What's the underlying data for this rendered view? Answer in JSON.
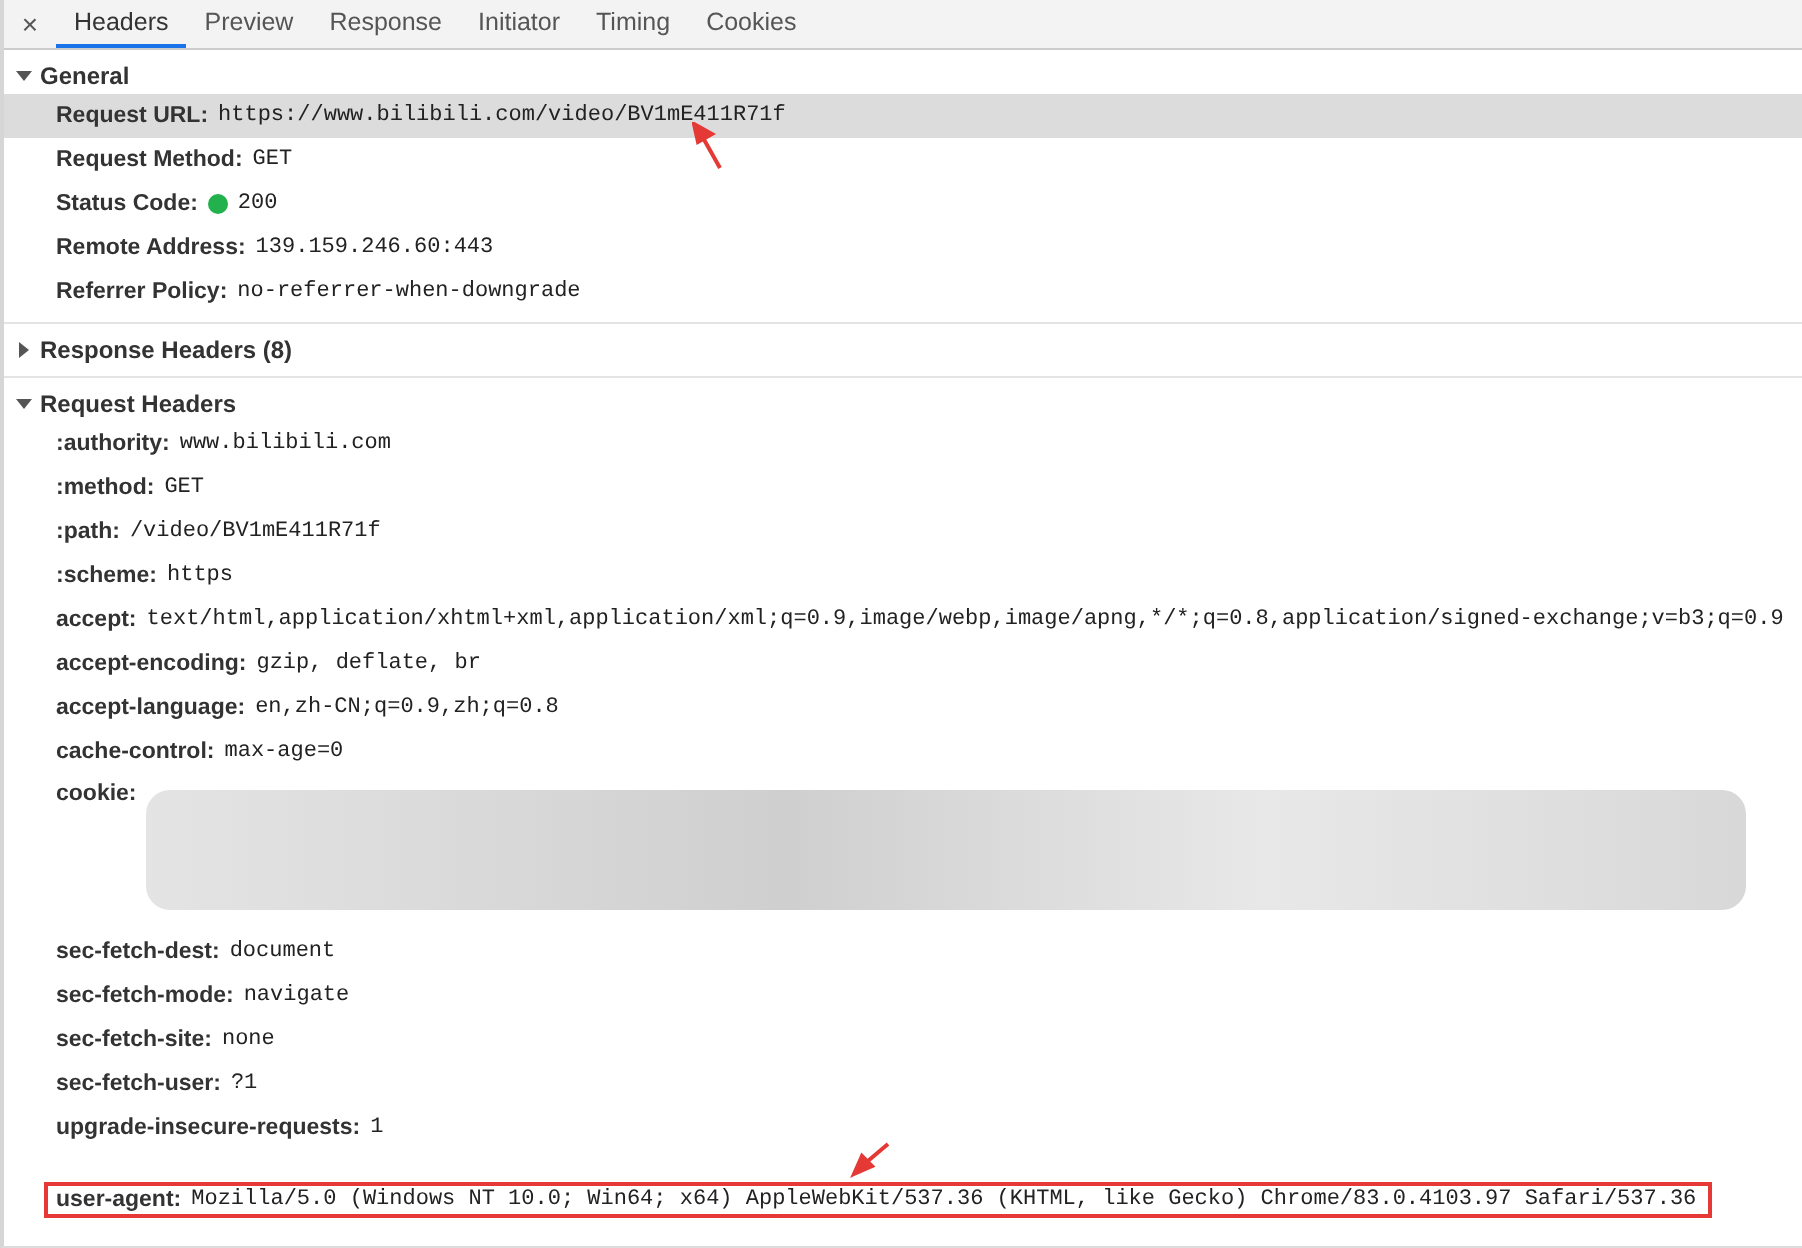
{
  "close_button": "×",
  "tabs": [
    {
      "label": "Headers",
      "selected": true
    },
    {
      "label": "Preview",
      "selected": false
    },
    {
      "label": "Response",
      "selected": false
    },
    {
      "label": "Initiator",
      "selected": false
    },
    {
      "label": "Timing",
      "selected": false
    },
    {
      "label": "Cookies",
      "selected": false
    }
  ],
  "sections": [
    {
      "title": "General",
      "expanded": true,
      "rows": [
        {
          "kind": "plain",
          "name": "Request URL:",
          "value": "https://www.bilibili.com/video/BV1mE411R71f",
          "selected": true,
          "arrow": true
        },
        {
          "kind": "plain",
          "name": "Request Method:",
          "value": "GET",
          "selected": false
        },
        {
          "kind": "status",
          "name": "Status Code:",
          "value": "200",
          "color": "#22b14c",
          "selected": false
        },
        {
          "kind": "plain",
          "name": "Remote Address:",
          "value": "139.159.246.60:443",
          "selected": false
        },
        {
          "kind": "plain",
          "name": "Referrer Policy:",
          "value": "no-referrer-when-downgrade",
          "selected": false
        }
      ]
    },
    {
      "title": "Response Headers (8)",
      "expanded": false
    },
    {
      "title": "Request Headers",
      "expanded": true,
      "rows": [
        {
          "kind": "plain",
          "name": ":authority:",
          "value": "www.bilibili.com",
          "selected": false
        },
        {
          "kind": "plain",
          "name": ":method:",
          "value": "GET",
          "selected": false
        },
        {
          "kind": "plain",
          "name": ":path:",
          "value": "/video/BV1mE411R71f",
          "selected": false
        },
        {
          "kind": "plain",
          "name": ":scheme:",
          "value": "https",
          "selected": false
        },
        {
          "kind": "plain",
          "name": "accept:",
          "value": "text/html,application/xhtml+xml,application/xml;q=0.9,image/webp,image/apng,*/*;q=0.8,application/signed-exchange;v=b3;q=0.9",
          "selected": false
        },
        {
          "kind": "plain",
          "name": "accept-encoding:",
          "value": "gzip, deflate, br",
          "selected": false
        },
        {
          "kind": "plain",
          "name": "accept-language:",
          "value": "en,zh-CN;q=0.9,zh;q=0.8",
          "selected": false
        },
        {
          "kind": "plain",
          "name": "cache-control:",
          "value": "max-age=0",
          "selected": false
        },
        {
          "kind": "redacted",
          "name": "cookie:",
          "selected": false
        },
        {
          "kind": "plain",
          "name": "sec-fetch-dest:",
          "value": "document",
          "selected": false
        },
        {
          "kind": "plain",
          "name": "sec-fetch-mode:",
          "value": "navigate",
          "selected": false
        },
        {
          "kind": "plain",
          "name": "sec-fetch-site:",
          "value": "none",
          "selected": false
        },
        {
          "kind": "plain",
          "name": "sec-fetch-user:",
          "value": "?1",
          "selected": false
        },
        {
          "kind": "plain",
          "name": "upgrade-insecure-requests:",
          "value": "1",
          "selected": false
        },
        {
          "kind": "plain",
          "name": "user-agent:",
          "value": "Mozilla/5.0 (Windows NT 10.0; Win64; x64) AppleWebKit/537.36 (KHTML, like Gecko) Chrome/83.0.4103.97 Safari/537.36",
          "selected": false,
          "arrow": true,
          "boxed": true
        }
      ]
    }
  ]
}
